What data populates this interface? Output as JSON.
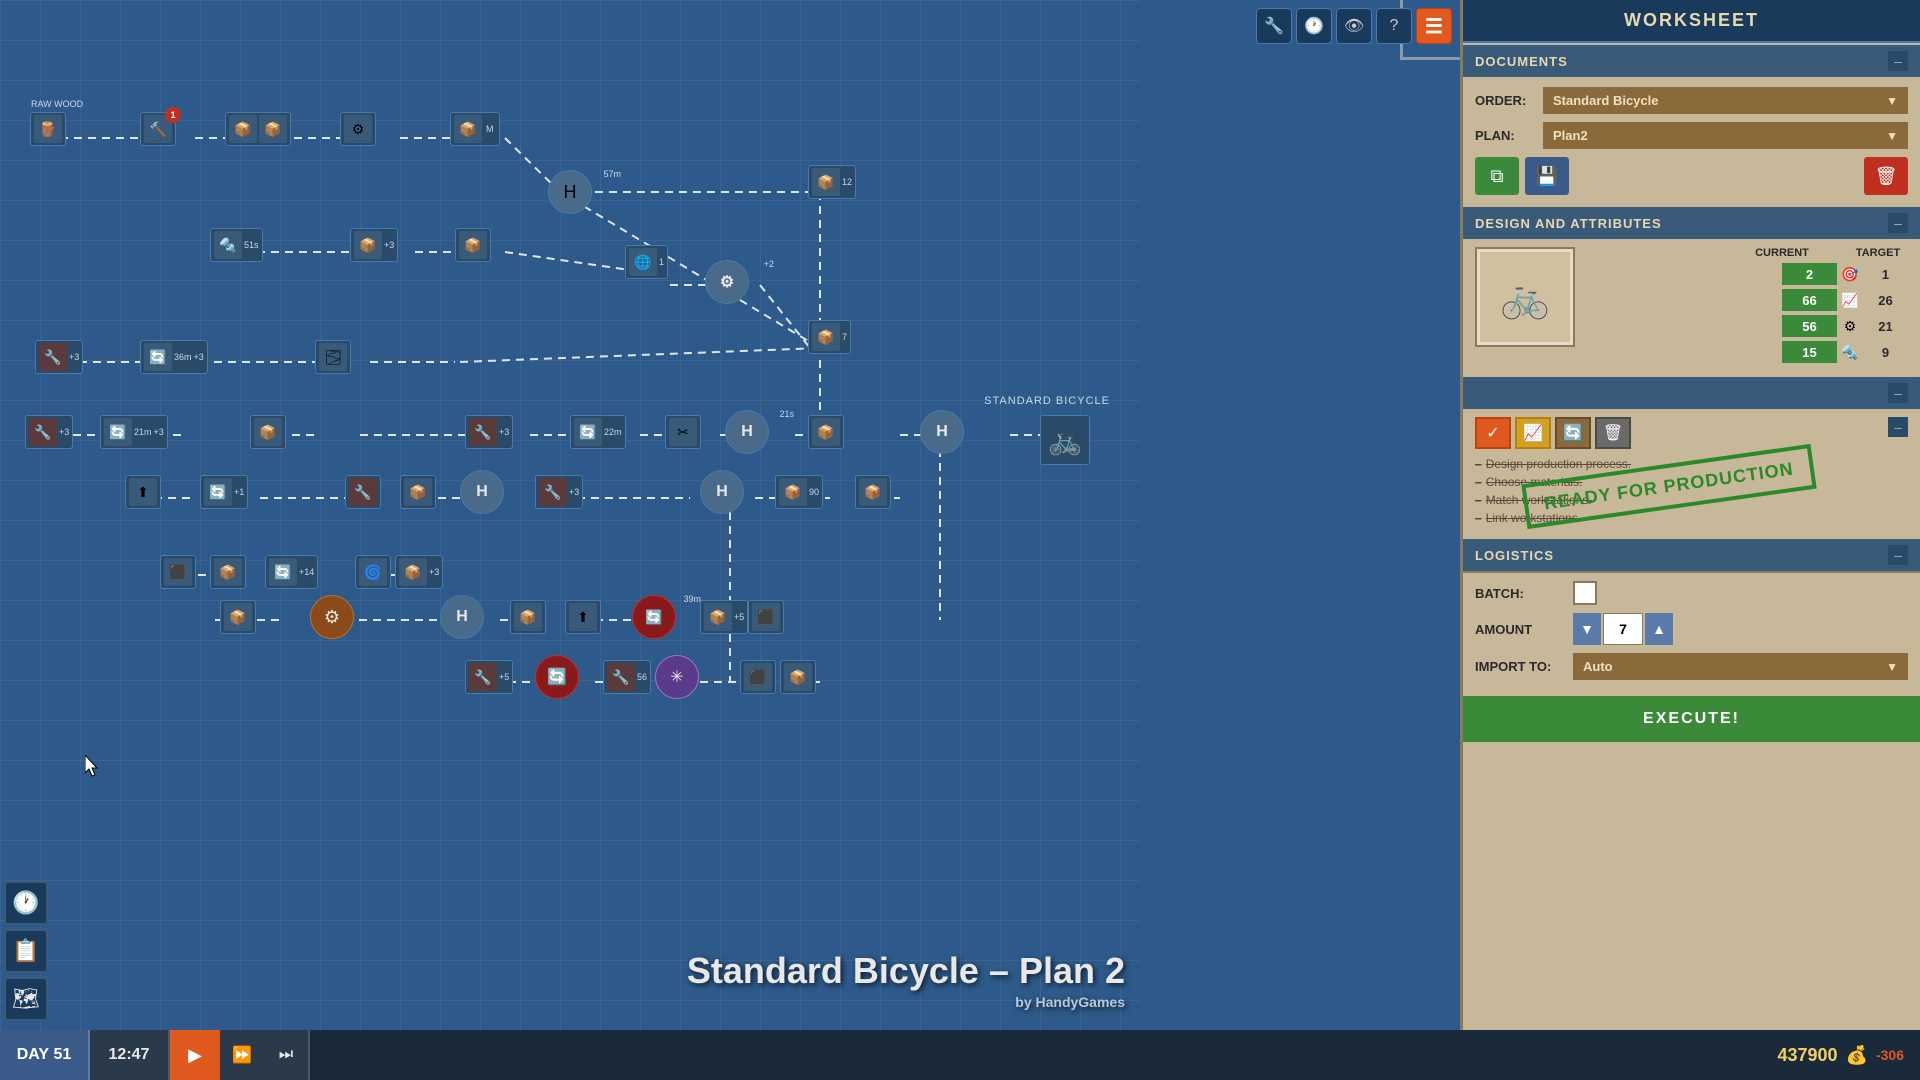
{
  "canvas": {
    "title": "Standard Bicycle – Plan 2",
    "subtitle": "by HandyGames",
    "standard_bicycle_label": "STANDARD BICYCLE"
  },
  "toolbar": {
    "wrench_label": "🔧",
    "clock_label": "🕐",
    "eye_label": "👁",
    "question_label": "?",
    "menu_label": "☰"
  },
  "worksheet": {
    "header": "WORKSHEET",
    "documents_header": "DOCUMENTS",
    "order_label": "ORDER:",
    "order_value": "Standard Bicycle",
    "plan_label": "PLAN:",
    "plan_value": "Plan2",
    "copy_btn": "⧉",
    "save_btn": "💾",
    "delete_btn": "🗑"
  },
  "design": {
    "header": "DESIGN AND ATTRIBUTES",
    "current_label": "CURRENT",
    "target_label": "TARGET",
    "attributes": [
      {
        "icon": "🎯",
        "current": 2,
        "current_color": "green",
        "target": 1
      },
      {
        "icon": "📈",
        "current": 66,
        "current_color": "green",
        "target": 26
      },
      {
        "icon": "⚙",
        "current": 56,
        "current_color": "green",
        "target": 21
      },
      {
        "icon": "🔩",
        "current": 15,
        "current_color": "green",
        "target": 9
      }
    ]
  },
  "checklist": {
    "tabs": [
      {
        "icon": "✓",
        "type": "active"
      },
      {
        "icon": "📈",
        "type": "yellow"
      },
      {
        "icon": "🔄",
        "type": "brown"
      },
      {
        "icon": "🗑",
        "type": "gray"
      }
    ],
    "items": [
      "Design production process.",
      "Choose materials.",
      "Match workstations.",
      "Link workstations."
    ],
    "stamp": "READY FOR PRODUCTION"
  },
  "logistics": {
    "header": "LOGISTICS",
    "batch_label": "BATCH:",
    "amount_label": "AMOUNT",
    "import_label": "IMPORT TO:",
    "amount_value": "7",
    "import_value": "Auto",
    "execute_label": "EXECUTE!"
  },
  "status_bar": {
    "day_label": "DAY",
    "day_value": "51",
    "time_value": "12:47",
    "money_value": "437900",
    "money_change": "-306",
    "currency_icon": "💰"
  }
}
